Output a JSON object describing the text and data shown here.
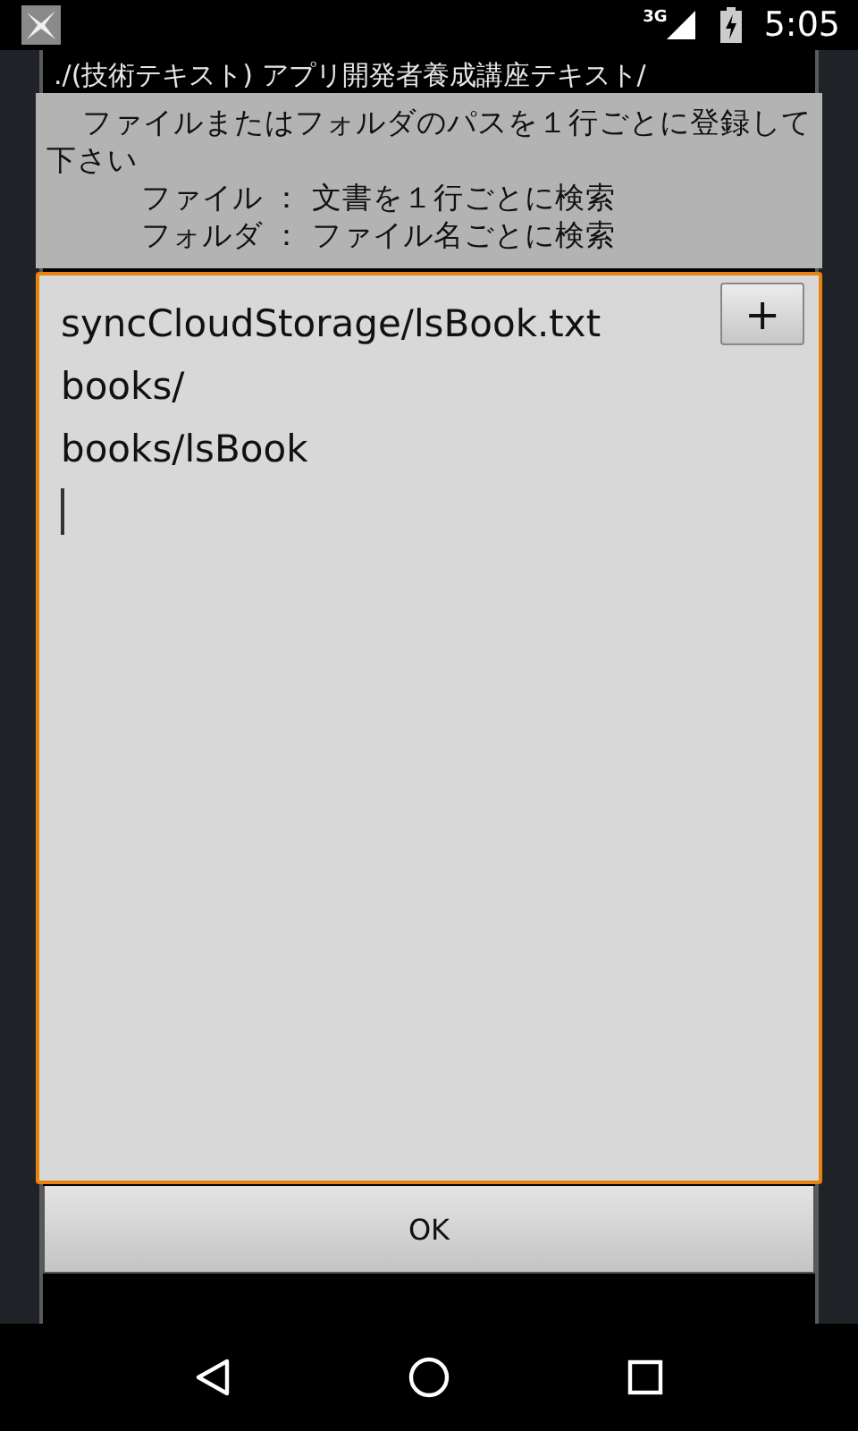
{
  "status_bar": {
    "network": "3G",
    "time": "5:05"
  },
  "background_list": {
    "items": [
      "./(技術テキスト) アプリ開発者養成講座テキスト/"
    ]
  },
  "dialog": {
    "message": "ファイルまたはフォルダのパスを１行ごとに登録して下さい",
    "notes": [
      "ファイル ： 文書を１行ごとに検索",
      "フォルダ ： ファイル名ごとに検索"
    ],
    "editor": {
      "lines": [
        "syncCloudStorage/lsBook.txt",
        "books/",
        "books/lsBook"
      ]
    },
    "add_button": "+",
    "ok_button": "OK"
  }
}
